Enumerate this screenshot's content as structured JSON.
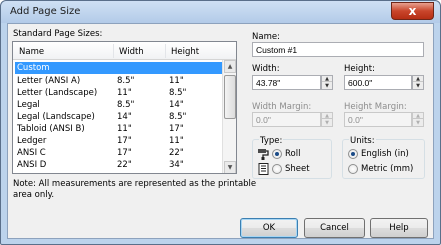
{
  "window": {
    "title": "Add Page Size",
    "close_glyph": "x"
  },
  "standard_sizes": {
    "label": "Standard Page Sizes:",
    "columns": [
      "Name",
      "Width",
      "Height"
    ],
    "rows": [
      {
        "name": "Custom",
        "width": "",
        "height": ""
      },
      {
        "name": "Letter (ANSI A)",
        "width": "8.5\"",
        "height": "11\""
      },
      {
        "name": "Letter (Landscape)",
        "width": "11\"",
        "height": "8.5\""
      },
      {
        "name": "Legal",
        "width": "8.5\"",
        "height": "14\""
      },
      {
        "name": "Legal (Landscape)",
        "width": "14\"",
        "height": "8.5\""
      },
      {
        "name": "Tabloid (ANSI B)",
        "width": "11\"",
        "height": "17\""
      },
      {
        "name": "Ledger",
        "width": "17\"",
        "height": "11\""
      },
      {
        "name": "ANSI C",
        "width": "17\"",
        "height": "22\""
      },
      {
        "name": "ANSI D",
        "width": "22\"",
        "height": "34\""
      }
    ],
    "selected_index": 0
  },
  "note": {
    "line1": "Note:  All measurements are represented as the printable",
    "line2": "area only."
  },
  "fields": {
    "name_label": "Name:",
    "name_value": "Custom #1",
    "width_label": "Width:",
    "width_value": "43.78\"",
    "height_label": "Height:",
    "height_value": "600.0\"",
    "width_margin_label": "Width Margin:",
    "width_margin_value": "0.0\"",
    "height_margin_label": "Height Margin:",
    "height_margin_value": "0.0\""
  },
  "type_group": {
    "label": "Type:",
    "options": [
      "Roll",
      "Sheet"
    ],
    "selected": "Roll"
  },
  "units_group": {
    "label": "Units:",
    "options": [
      "English (in)",
      "Metric (mm)"
    ],
    "selected": "English (in)"
  },
  "buttons": {
    "ok": "OK",
    "cancel": "Cancel",
    "help": "Help"
  },
  "icons": {
    "roll": "paint-roller-icon",
    "sheet": "document-sheet-icon"
  }
}
